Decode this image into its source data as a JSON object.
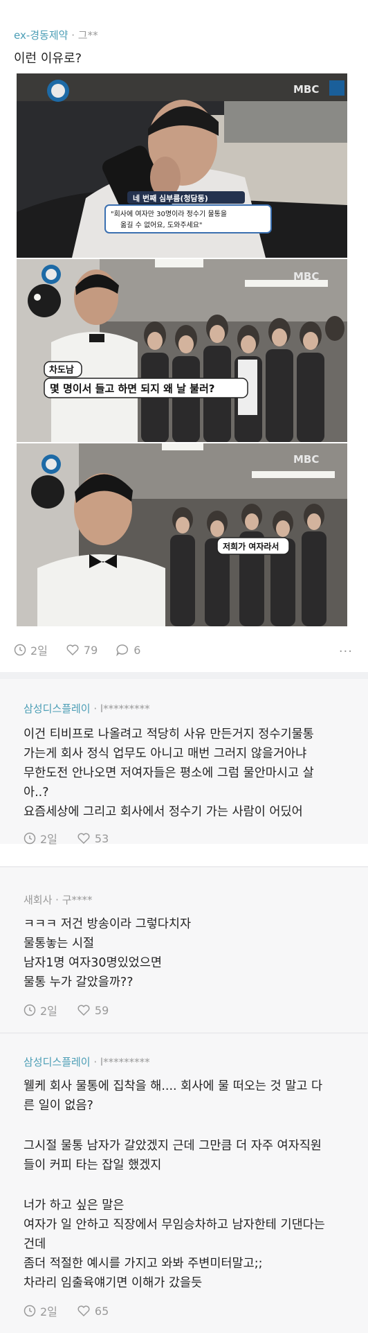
{
  "post": {
    "company": "ex-경동제약",
    "author": " · 그**",
    "text": "이런 이유로?",
    "frames": [
      {
        "logo": "MBC",
        "caption_title": "네 번째 심부름(청담동)",
        "caption_line1": "\"회사에 여자만 30명이라 정수기 물통을",
        "caption_line2": "옮길 수 없어요, 도와주세요\""
      },
      {
        "logo": "MBC",
        "tag": "차도남",
        "subtitle": "몇 명이서 들고 하면 되지 왜 날 불러?"
      },
      {
        "logo": "MBC",
        "subtitle": "저희가 여자라서"
      }
    ],
    "stats": {
      "time": "2일",
      "likes": "79",
      "comments": "6"
    },
    "more": "···"
  },
  "comments": [
    {
      "company": "삼성디스플레이",
      "author": " · l*********",
      "lines": [
        "이건 티비프로 나올려고 적당히 사유 만든거지 정수기물통",
        "가는게 회사 정식 업무도 아니고 매번 그러지 않을거아냐",
        "무한도전 안나오면 저여자들은 평소에 그럼 물안마시고 살",
        "아..?",
        "요즘세상에 그리고 회사에서 정수기 가는 사람이 어딨어"
      ],
      "time": "2일",
      "likes": "53"
    },
    {
      "company": "새회사",
      "author": " · 구****",
      "lines": [
        "ㅋㅋㅋ 저건 방송이라 그렇다치자",
        "물통놓는 시절",
        "남자1명 여자30명있었으면",
        "물통 누가 갈았을까??"
      ],
      "time": "2일",
      "likes": "59"
    },
    {
      "company": "삼성디스플레이",
      "author": " · l*********",
      "lines": [
        "웰케 회사 물통에 집착을 해.... 회사에 물 떠오는 것 말고 다",
        "른 일이 없음?",
        "",
        "그시절 물통 남자가 갈았겠지 근데 그만큼 더 자주 여자직원",
        "들이 커피 타는 잡일 했겠지",
        "",
        "너가 하고 싶은 말은",
        "여자가 일 안하고 직장에서 무임승차하고 남자한테 기댄다는",
        "건데",
        "좀더 적절한 예시를 가지고 와봐 주변미터말고;;",
        "차라리 임출육얘기면 이해가 갔을듯"
      ],
      "time": "2일",
      "likes": "65"
    }
  ]
}
